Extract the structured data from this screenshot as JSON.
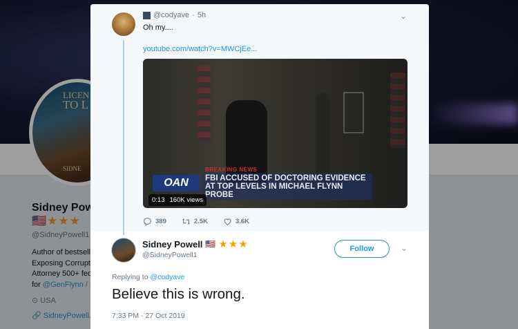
{
  "background_profile": {
    "avatar_text_line1": "LICEN",
    "avatar_text_line2": "TO L",
    "avatar_text_line3": "SIDNE",
    "name": "Sidney Pow",
    "handle": "@SidneyPowell1",
    "bio_lines": [
      "Author of bestsell",
      "Exposing Corrupt",
      "Attorney 500+ fed",
      "for"
    ],
    "bio_mentions": [
      "@GenFlynn",
      "/ #"
    ],
    "location": "USA",
    "website": "SidneyPowell."
  },
  "parent_tweet": {
    "username": "@cody",
    "username_rest": "ave",
    "time": "5h",
    "text": "Oh my....",
    "link": "youtube.com/watch?v=MWCjEe...",
    "video": {
      "channel_logo": "OAN",
      "breaking_label": "BREAKING NEWS",
      "headline_line1": "FBI ACCUSED OF DOCTORING EVIDENCE",
      "headline_line2": "AT TOP LEVELS IN MICHAEL FLYNN PROBE",
      "duration": "0:13",
      "views": "160K views"
    },
    "actions": {
      "replies": "389",
      "retweets": "2.5K",
      "likes": "3.6K"
    }
  },
  "main_tweet": {
    "name": "Sidney Powell",
    "flag": "🇺🇸",
    "stars": "★★★",
    "handle": "@SidneyPowell1",
    "follow_label": "Follow",
    "replying_prefix": "Replying to",
    "replying_to": "@codyave",
    "text": "Believe this is wrong.",
    "timestamp": "7:33 PM - 27 Oct 2019"
  },
  "colors": {
    "link": "#1b95e0",
    "secondary_text": "#657786",
    "thread_line": "#a0d2f2",
    "star": "#f4a300"
  }
}
